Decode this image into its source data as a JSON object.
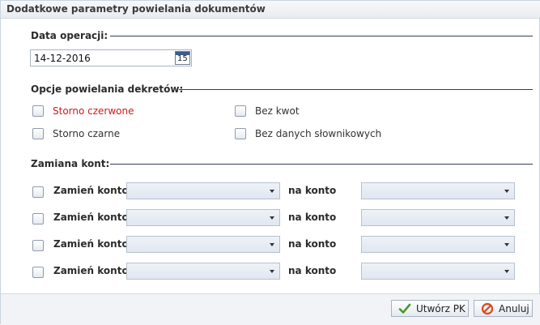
{
  "dialog": {
    "title": "Dodatkowe parametry powielania dokumentów"
  },
  "date_section": {
    "label": "Data operacji:",
    "value": "14-12-2016",
    "calendar_day": "15"
  },
  "options_section": {
    "label": "Opcje powielania dekretów:",
    "options": [
      {
        "label": "Storno czerwone",
        "checked": false,
        "color": "#d11a1a"
      },
      {
        "label": "Bez kwot",
        "checked": false
      },
      {
        "label": "Storno czarne",
        "checked": false
      },
      {
        "label": "Bez danych słownikowych",
        "checked": false
      }
    ]
  },
  "swap_section": {
    "label": "Zamiana kont:",
    "rows": [
      {
        "from_label": "Zamień konto",
        "to_label": "na konto",
        "from_value": "",
        "to_value": "",
        "checked": false
      },
      {
        "from_label": "Zamień konto",
        "to_label": "na konto",
        "from_value": "",
        "to_value": "",
        "checked": false
      },
      {
        "from_label": "Zamień konto",
        "to_label": "na konto",
        "from_value": "",
        "to_value": "",
        "checked": false
      },
      {
        "from_label": "Zamień konto",
        "to_label": "na konto",
        "from_value": "",
        "to_value": "",
        "checked": false
      }
    ]
  },
  "footer": {
    "create_label": "Utwórz PK",
    "cancel_label": "Anuluj",
    "create_icon": "checkmark-icon",
    "cancel_icon": "cancel-icon",
    "accent_colors": {
      "check": "#4a9a2a",
      "cancel": "#d9481c"
    }
  }
}
